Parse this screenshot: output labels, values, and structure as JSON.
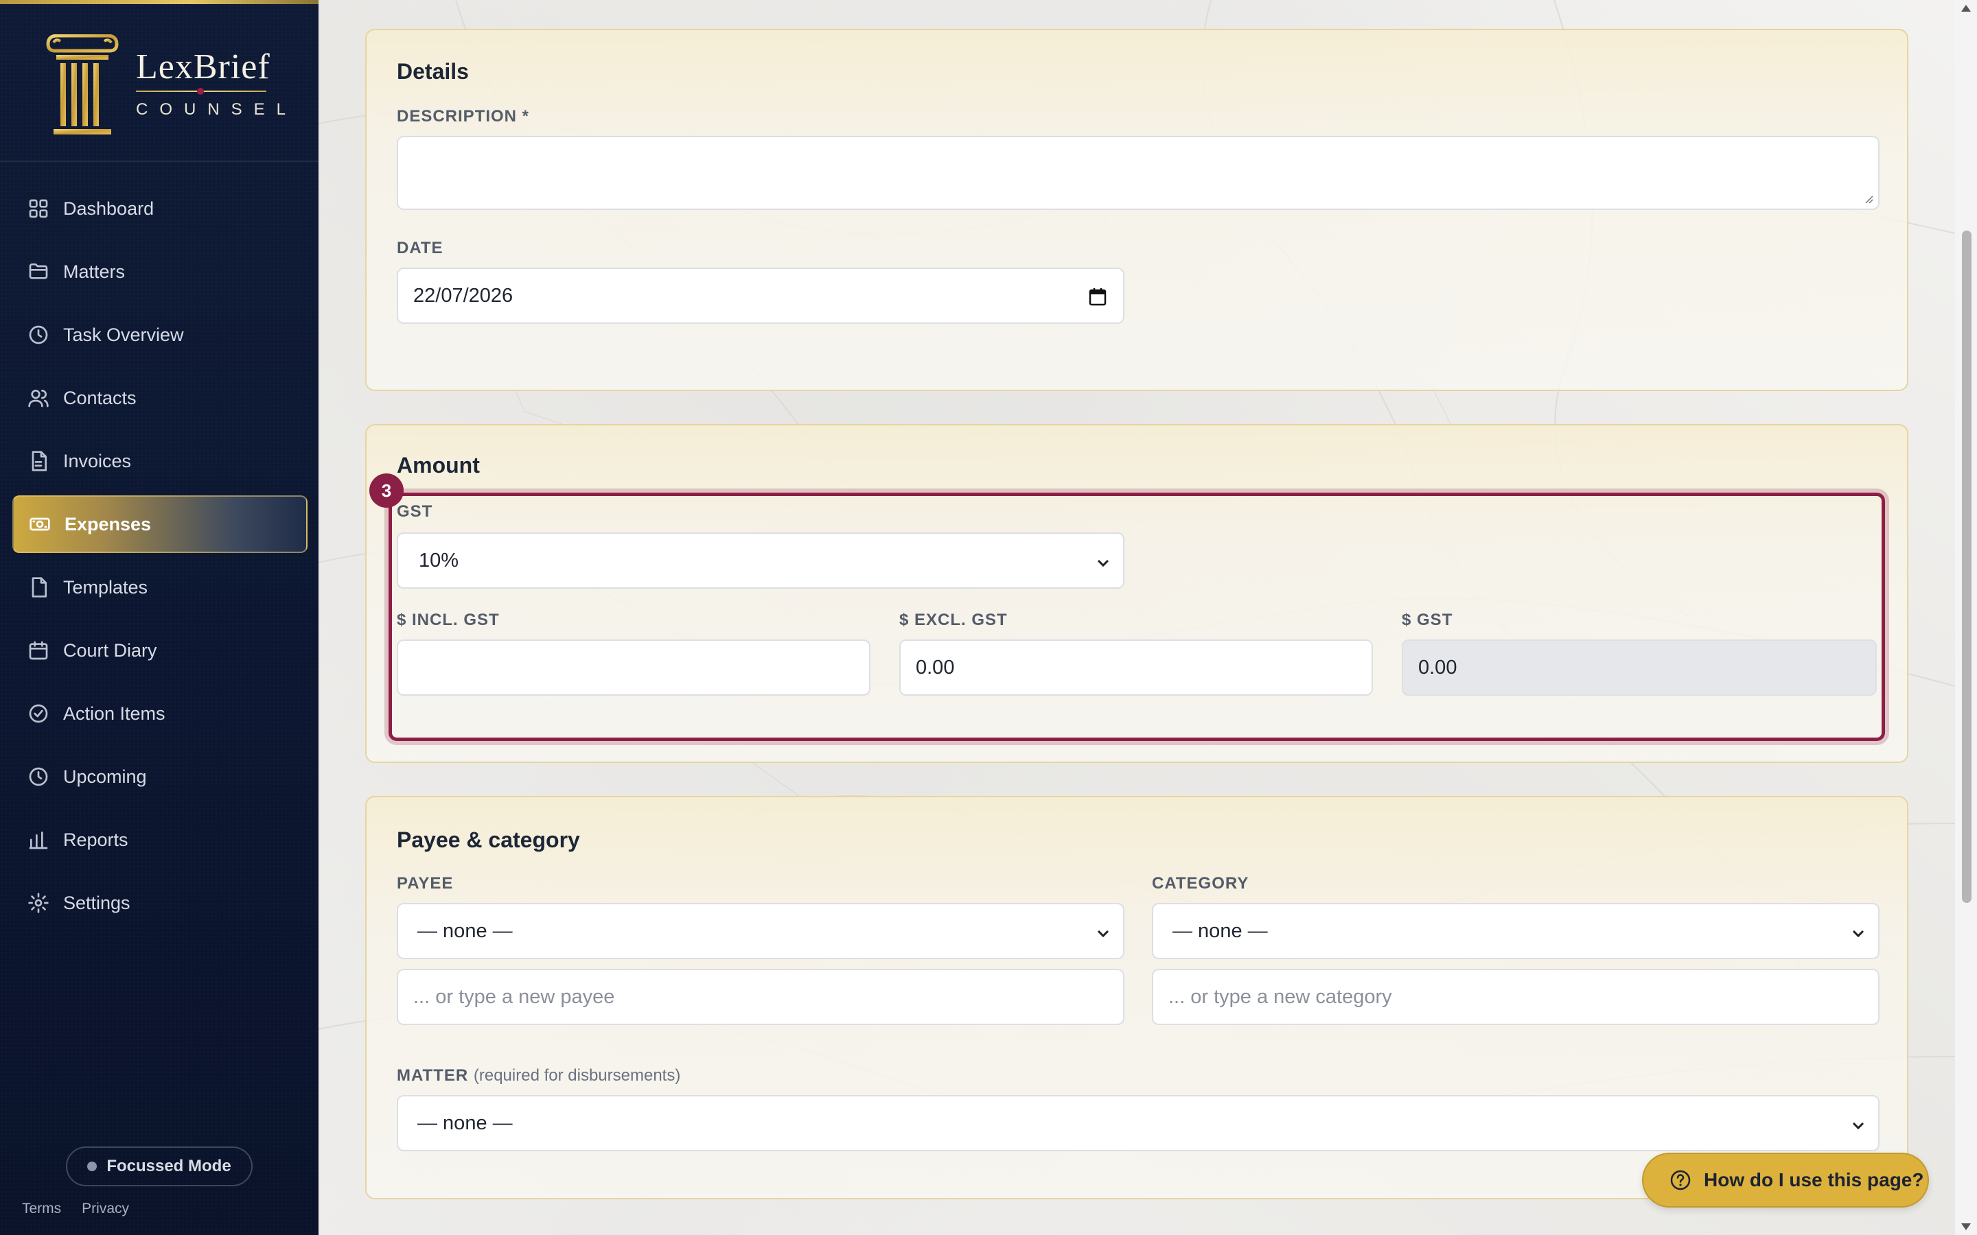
{
  "brand": {
    "name": "LexBrief",
    "sub": "COUNSEL"
  },
  "nav": [
    {
      "label": "Dashboard",
      "icon": "grid-icon"
    },
    {
      "label": "Matters",
      "icon": "folder-icon"
    },
    {
      "label": "Task Overview",
      "icon": "clock-icon"
    },
    {
      "label": "Contacts",
      "icon": "users-icon"
    },
    {
      "label": "Invoices",
      "icon": "document-icon"
    },
    {
      "label": "Expenses",
      "icon": "cash-icon",
      "active": true
    },
    {
      "label": "Templates",
      "icon": "file-icon"
    },
    {
      "label": "Court Diary",
      "icon": "calendar-icon"
    },
    {
      "label": "Action Items",
      "icon": "check-circle-icon"
    },
    {
      "label": "Upcoming",
      "icon": "clock-icon"
    },
    {
      "label": "Reports",
      "icon": "bar-chart-icon"
    },
    {
      "label": "Settings",
      "icon": "gear-icon"
    }
  ],
  "sidebar_footer": {
    "focus_mode": "Focussed Mode",
    "terms": "Terms",
    "privacy": "Privacy"
  },
  "details": {
    "title": "Details",
    "description_label": "DESCRIPTION *",
    "description_value": "",
    "date_label": "DATE",
    "date_value": "22/07/2026"
  },
  "amount": {
    "title": "Amount",
    "step_badge": "3",
    "gst_label": "GST",
    "gst_value": "10%",
    "incl_label": "$ INCL. GST",
    "incl_value": "",
    "excl_label": "$ EXCL. GST",
    "excl_value": "0.00",
    "gst_amount_label": "$ GST",
    "gst_amount_value": "0.00"
  },
  "payee_category": {
    "title": "Payee & category",
    "payee_label": "PAYEE",
    "payee_value": "— none —",
    "payee_new_placeholder": "... or type a new payee",
    "category_label": "CATEGORY",
    "category_value": "— none —",
    "category_new_placeholder": "... or type a new category",
    "matter_label": "MATTER",
    "matter_note": "(required for disbursements)",
    "matter_value": "— none —"
  },
  "help": {
    "label": "How do I use this page?"
  },
  "colors": {
    "sidebar_bg": "#0f1b36",
    "accent_gold": "#dcb13c",
    "highlight": "#8c1f45"
  }
}
